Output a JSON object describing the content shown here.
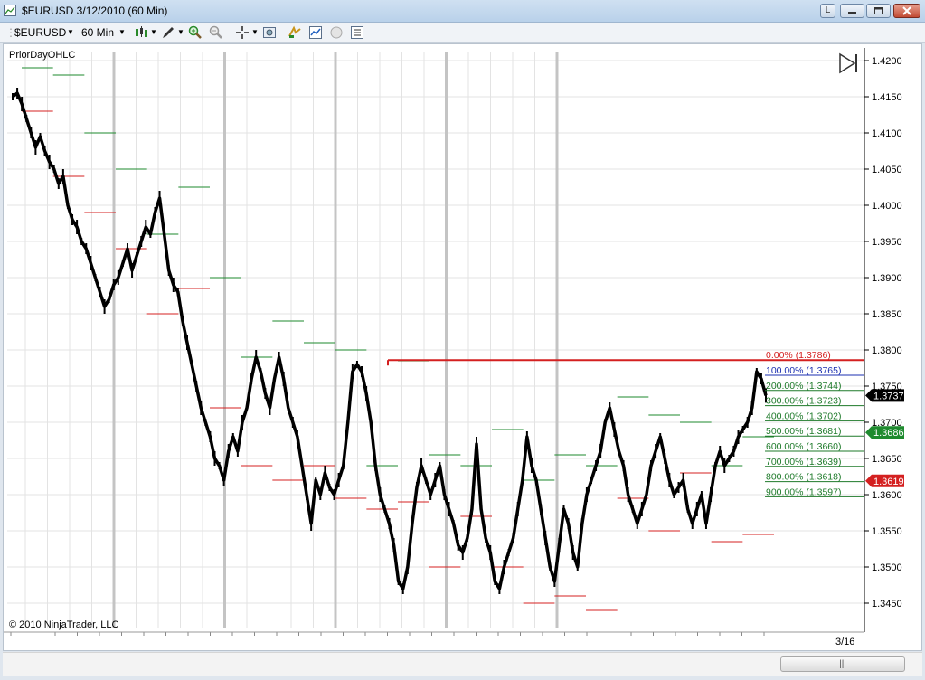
{
  "window": {
    "title": "$EURUSD  3/12/2010 (60 Min)",
    "buttons": [
      "L",
      "–",
      "□",
      "✕"
    ]
  },
  "toolbar": {
    "instrument": "$EURUSD",
    "interval": "60 Min",
    "icons": [
      "candlestick-style-icon",
      "drawing-pencil-icon",
      "zoom-in-icon",
      "zoom-out-icon",
      "crosshair-icon",
      "snapshot-icon",
      "strategies-icon",
      "indicators-icon",
      "circle-icon",
      "properties-icon"
    ]
  },
  "chart": {
    "indicator_label": "PriorDayOHLC",
    "copyright": "© 2010 NinjaTrader, LLC",
    "x_axis_label": "3/16",
    "y_ticks": [
      "1.4200",
      "1.4150",
      "1.4100",
      "1.4050",
      "1.4000",
      "1.3950",
      "1.3900",
      "1.3850",
      "1.3800",
      "1.3750",
      "1.3700",
      "1.3650",
      "1.3600",
      "1.3550",
      "1.3500",
      "1.3450"
    ],
    "price_markers": [
      {
        "label": "1.3737",
        "bg": "#000000"
      },
      {
        "label": "1.3686",
        "bg": "#1e8a2e"
      },
      {
        "label": "1.3619",
        "bg": "#d42020"
      }
    ],
    "fib_levels": [
      {
        "text": "0.00% (1.3786)",
        "color": "#d42020"
      },
      {
        "text": "100.00% (1.3765)",
        "color": "#1b2fb0"
      },
      {
        "text": "200.00% (1.3744)",
        "color": "#1e7a2a"
      },
      {
        "text": "300.00% (1.3723)",
        "color": "#1e7a2a"
      },
      {
        "text": "400.00% (1.3702)",
        "color": "#1e7a2a"
      },
      {
        "text": "500.00% (1.3681)",
        "color": "#1e7a2a"
      },
      {
        "text": "600.00% (1.3660)",
        "color": "#1e7a2a"
      },
      {
        "text": "700.00% (1.3639)",
        "color": "#1e7a2a"
      },
      {
        "text": "800.00% (1.3618)",
        "color": "#1e7a2a"
      },
      {
        "text": "900.00% (1.3597)",
        "color": "#1e7a2a"
      }
    ],
    "colors": {
      "bull_line": "#000000",
      "resistance": "#d42020",
      "prior_high": "#1e8a2e",
      "prior_low": "#d42020"
    }
  },
  "chart_data": {
    "type": "line",
    "ylim": [
      1.3425,
      1.4225
    ],
    "series": [
      {
        "values": [
          1.415,
          1.4155,
          1.414,
          1.412,
          1.41,
          1.408,
          1.4095,
          1.4075,
          1.406,
          1.405,
          1.403,
          1.404,
          1.4,
          1.398,
          1.397,
          1.395,
          1.394,
          1.392,
          1.39,
          1.388,
          1.386,
          1.387,
          1.389,
          1.39,
          1.392,
          1.394,
          1.391,
          1.393,
          1.395,
          1.397,
          1.396,
          1.399,
          1.401,
          1.396,
          1.391,
          1.389,
          1.388,
          1.384,
          1.381,
          1.378,
          1.375,
          1.372,
          1.37,
          1.368,
          1.365,
          1.364,
          1.362,
          1.366,
          1.368,
          1.366,
          1.37,
          1.372,
          1.376,
          1.379,
          1.377,
          1.374,
          1.372,
          1.376,
          1.379,
          1.376,
          1.372,
          1.37,
          1.368,
          1.364,
          1.36,
          1.356,
          1.362,
          1.36,
          1.363,
          1.361,
          1.36,
          1.362,
          1.364,
          1.37,
          1.377,
          1.378,
          1.377,
          1.374,
          1.37,
          1.364,
          1.36,
          1.358,
          1.356,
          1.353,
          1.348,
          1.347,
          1.35,
          1.356,
          1.361,
          1.364,
          1.362,
          1.36,
          1.362,
          1.364,
          1.36,
          1.358,
          1.356,
          1.353,
          1.352,
          1.354,
          1.358,
          1.367,
          1.358,
          1.354,
          1.352,
          1.348,
          1.347,
          1.35,
          1.352,
          1.354,
          1.358,
          1.362,
          1.368,
          1.364,
          1.362,
          1.358,
          1.354,
          1.35,
          1.348,
          1.353,
          1.358,
          1.356,
          1.352,
          1.35,
          1.356,
          1.36,
          1.362,
          1.364,
          1.366,
          1.37,
          1.372,
          1.369,
          1.366,
          1.364,
          1.36,
          1.358,
          1.356,
          1.358,
          1.36,
          1.364,
          1.366,
          1.368,
          1.365,
          1.362,
          1.36,
          1.361,
          1.362,
          1.358,
          1.356,
          1.358,
          1.36,
          1.356,
          1.36,
          1.364,
          1.366,
          1.364,
          1.365,
          1.366,
          1.368,
          1.369,
          1.37,
          1.372,
          1.377,
          1.376,
          1.3737
        ]
      }
    ],
    "prior_day_levels": [
      {
        "high": 1.419,
        "low": 1.413
      },
      {
        "high": 1.418,
        "low": 1.404
      },
      {
        "high": 1.41,
        "low": 1.399
      },
      {
        "high": 1.405,
        "low": 1.394
      },
      {
        "high": 1.396,
        "low": 1.385
      },
      {
        "high": 1.4025,
        "low": 1.3885
      },
      {
        "high": 1.39,
        "low": 1.372
      },
      {
        "high": 1.379,
        "low": 1.364
      },
      {
        "high": 1.384,
        "low": 1.362
      },
      {
        "high": 1.381,
        "low": 1.364
      },
      {
        "high": 1.38,
        "low": 1.3595
      },
      {
        "high": 1.364,
        "low": 1.358
      },
      {
        "high": 1.3785,
        "low": 1.359
      },
      {
        "high": 1.3655,
        "low": 1.35
      },
      {
        "high": 1.364,
        "low": 1.357
      },
      {
        "high": 1.369,
        "low": 1.35
      },
      {
        "high": 1.362,
        "low": 1.345
      },
      {
        "high": 1.3655,
        "low": 1.346
      },
      {
        "high": 1.364,
        "low": 1.344
      },
      {
        "high": 1.3735,
        "low": 1.3595
      },
      {
        "high": 1.371,
        "low": 1.355
      },
      {
        "high": 1.37,
        "low": 1.363
      },
      {
        "high": 1.364,
        "low": 1.3535
      },
      {
        "high": 1.368,
        "low": 1.3545
      }
    ],
    "resistance_level": 1.3786
  }
}
